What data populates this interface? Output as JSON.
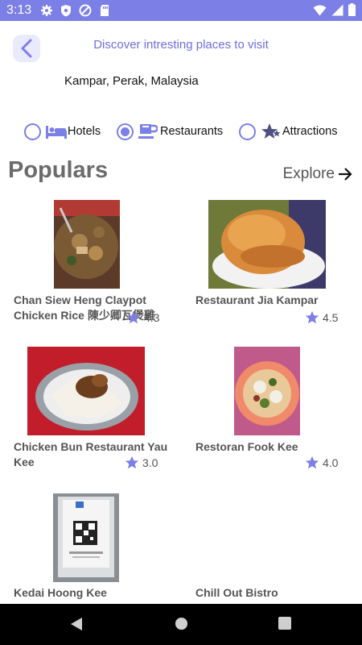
{
  "status_bar": {
    "time": "3:13",
    "background": "#7b7fe6",
    "left_icons": [
      "gear-icon",
      "shield-icon",
      "at-sign-icon",
      "sd-card-icon"
    ],
    "right_icons": [
      "wifi-icon",
      "signal-icon",
      "battery-icon"
    ]
  },
  "header": {
    "title": "Discover intresting places to visit",
    "location": "Kampar, Perak, Malaysia",
    "back_icon": "chevron-left-icon"
  },
  "filters": [
    {
      "label": "Hotels",
      "icon": "bed-icon",
      "selected": false
    },
    {
      "label": "Restaurants",
      "icon": "coffee-cup-icon",
      "selected": true
    },
    {
      "label": "Attractions",
      "icon": "stars-icon",
      "selected": false
    }
  ],
  "section": {
    "title": "Populars",
    "explore_label": "Explore",
    "explore_icon": "arrow-right-icon"
  },
  "places": [
    {
      "name": "Chan Siew Heng Claypot Chicken Rice 陳少卿瓦煲雞",
      "rating": "4.3",
      "photo": "claypot-chicken-rice-photo"
    },
    {
      "name": "Restaurant Jia Kampar",
      "rating": "4.5",
      "photo": "chicken-bun-photo"
    },
    {
      "name": "Chicken Bun Restaurant Yau Kee",
      "rating": "3.0",
      "photo": "chicken-bun-plate-photo"
    },
    {
      "name": "Restoran Fook Kee",
      "rating": "4.0",
      "photo": "noodles-bowl-photo"
    },
    {
      "name": "Kedai Hoong Kee",
      "rating": "",
      "photo": "qr-code-sign-photo"
    },
    {
      "name": "Chill Out Bistro",
      "rating": "",
      "photo": ""
    }
  ],
  "colors": {
    "accent": "#7b7fe6",
    "star": "#7b7fe6",
    "text_muted": "#555555"
  },
  "nav_bar": {
    "icons": [
      "back-triangle-icon",
      "home-circle-icon",
      "recents-square-icon"
    ]
  }
}
